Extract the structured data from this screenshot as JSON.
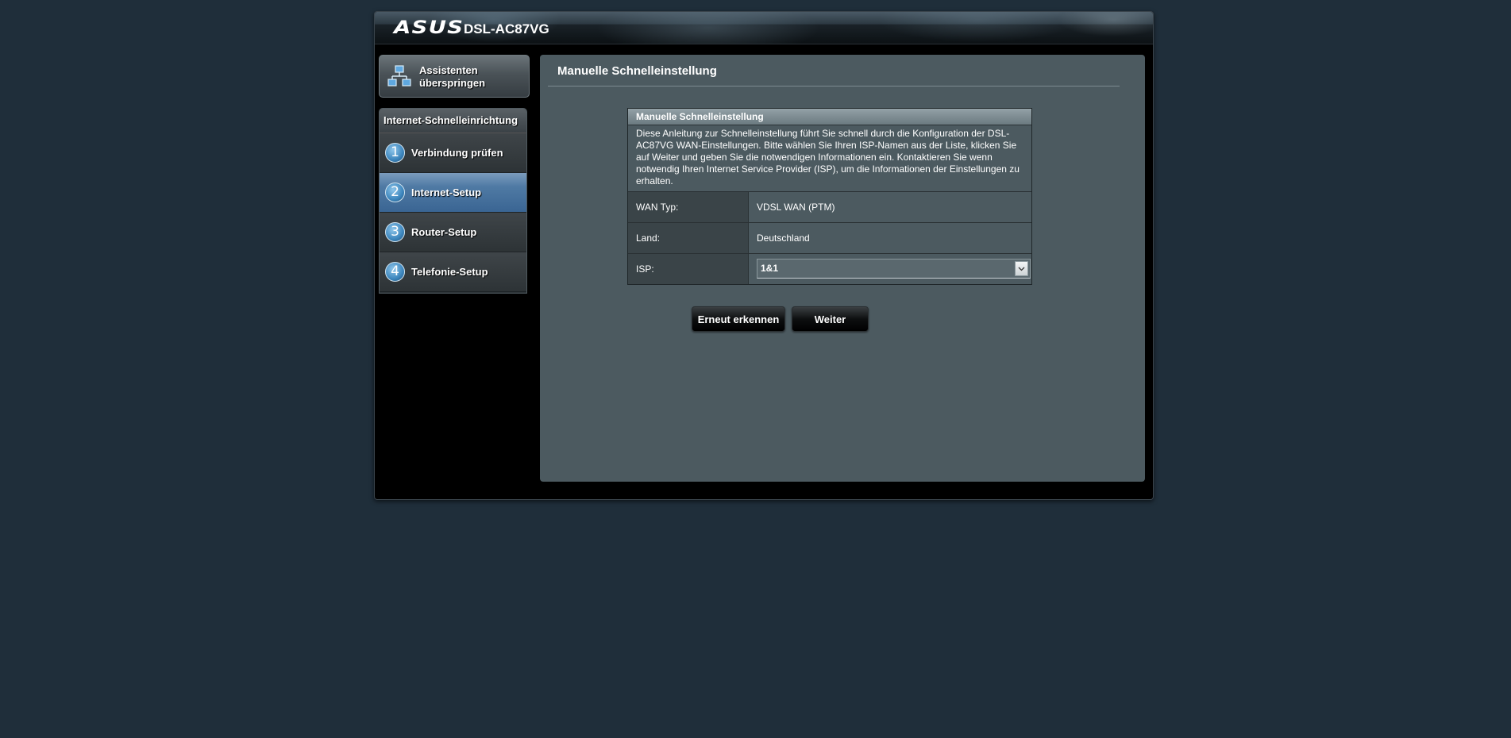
{
  "header": {
    "logo": "ASUS",
    "model": "DSL-AC87VG"
  },
  "sidebar": {
    "skip_button": "Assistenten überspringen",
    "menu_title": "Internet-Schnelleinrichtung",
    "steps": [
      {
        "number": "1",
        "label": "Verbindung prüfen",
        "active": false
      },
      {
        "number": "2",
        "label": "Internet-Setup",
        "active": true
      },
      {
        "number": "3",
        "label": "Router-Setup",
        "active": false
      },
      {
        "number": "4",
        "label": "Telefonie-Setup",
        "active": false
      }
    ]
  },
  "main": {
    "title": "Manuelle Schnelleinstellung",
    "table_header": "Manuelle Schnelleinstellung",
    "description": "Diese Anleitung zur Schnelleinstellung führt Sie schnell durch die Konfiguration der DSL-AC87VG WAN-Einstellungen. Bitte wählen Sie Ihren ISP-Namen aus der Liste, klicken Sie auf Weiter und geben Sie die notwendigen Informationen ein. Kontaktieren Sie wenn notwendig Ihren Internet Service Provider (ISP), um die Informationen der Einstellungen zu erhalten.",
    "fields": {
      "wan_type_label": "WAN Typ:",
      "wan_type_value": "VDSL WAN (PTM)",
      "country_label": "Land:",
      "country_value": "Deutschland",
      "isp_label": "ISP:",
      "isp_value": "1&1"
    },
    "buttons": {
      "redetect": "Erneut erkennen",
      "next": "Weiter"
    }
  },
  "icons": {
    "skip": "network-icon",
    "select_arrow": "chevron-down-icon"
  }
}
